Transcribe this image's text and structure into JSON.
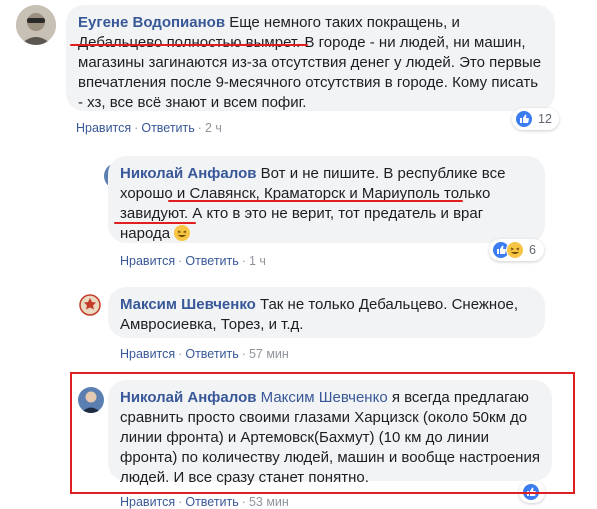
{
  "comments": [
    {
      "author": "Еугене Водопианов",
      "text_part1": " Еще немного таких покращень, и Дебальцево полностью вымрет. В городе - ни людей, ни машин, магазины загинаются из-за отсутствия денег у людей. Это первые впечатления после 9-месячного отсутствия в городе. Кому писать - хз, все всё знают и всем пофиг.",
      "like_label": "Нравится",
      "reply_label": "Ответить",
      "time": "2 ч",
      "reaction_count": "12"
    },
    {
      "author": "Николай Анфалов",
      "text_part1": " Вот и не пишите. В республике все хорошо и Славянск, Краматорск и Мариуполь только завидуют. А кто в это не верит, тот предатель и враг народа ",
      "like_label": "Нравится",
      "reply_label": "Ответить",
      "time": "1 ч",
      "reaction_count": "6"
    },
    {
      "author": "Максим Шевченко",
      "text_part1": " Так не только Дебальцево. Снежное, Амвросиевка, Торез, и т.д.",
      "like_label": "Нравится",
      "reply_label": "Ответить",
      "time": "57 мин"
    },
    {
      "author": "Николай Анфалов",
      "mention": "Максим Шевченко",
      "text_part1": " я всегда предлагаю сравнить просто своими глазами Харцизск (около 50км до линии фронта) и Артемовск(Бахмут) (10 км до линии фронта) по количеству людей, машин и вообще настроения людей. И все сразу станет понятно.",
      "like_label": "Нравится",
      "reply_label": "Ответить",
      "time": "53 мин"
    }
  ],
  "separator": "·",
  "colors": {
    "author": "#385898",
    "bubble": "#f2f3f5",
    "highlight": "#e02020",
    "like": "#3b7cf0"
  }
}
